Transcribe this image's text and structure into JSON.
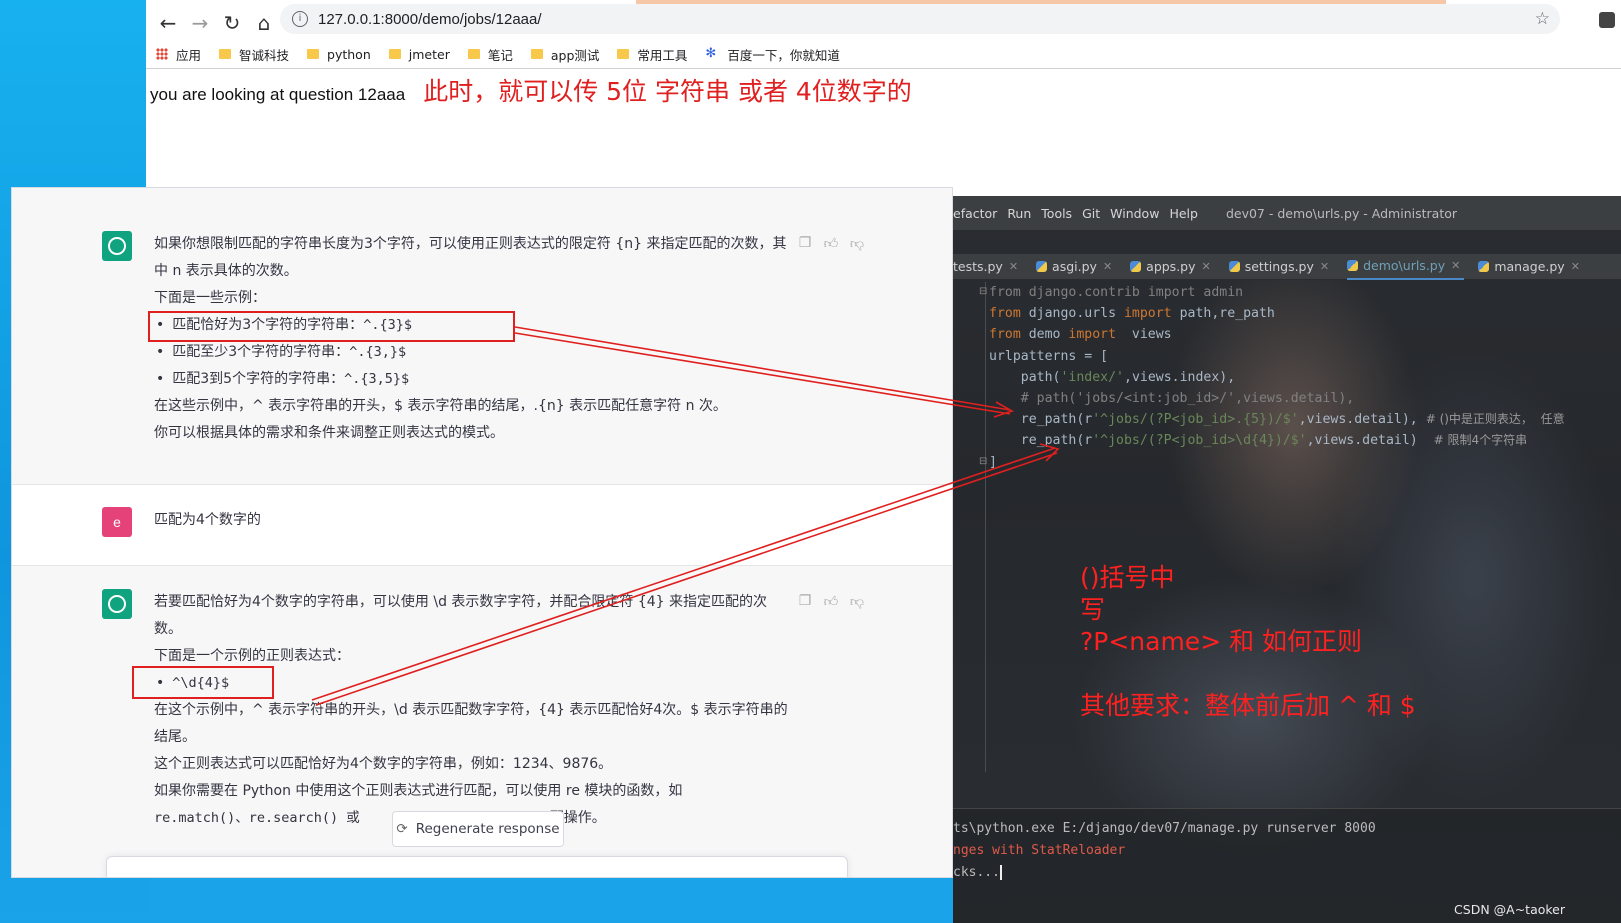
{
  "browser": {
    "url": "127.0.0.1:8000/demo/jobs/12aaa/",
    "bookmarks": [
      {
        "label": "应用",
        "icon": "apps-grid-icon"
      },
      {
        "label": "智诚科技",
        "icon": "folder-icon"
      },
      {
        "label": "python",
        "icon": "folder-icon"
      },
      {
        "label": "jmeter",
        "icon": "folder-icon"
      },
      {
        "label": "笔记",
        "icon": "folder-icon"
      },
      {
        "label": "app测试",
        "icon": "folder-icon"
      },
      {
        "label": "常用工具",
        "icon": "folder-icon"
      },
      {
        "label": "百度一下，你就知道",
        "icon": "baidu-paw-icon"
      }
    ],
    "page_text": "you are looking at question 12aaa",
    "page_note": "此时，就可以传 5位 字符串    或者  4位数字的"
  },
  "ide": {
    "menu": [
      "efactor",
      "Run",
      "Tools",
      "Git",
      "Window",
      "Help"
    ],
    "window_title": "dev07 - demo\\urls.py - Administrator",
    "tabs": [
      {
        "label": "tests.py",
        "active": false
      },
      {
        "label": "asgi.py",
        "active": false
      },
      {
        "label": "apps.py",
        "active": false
      },
      {
        "label": "settings.py",
        "active": false
      },
      {
        "label": "demo\\urls.py",
        "active": true
      },
      {
        "label": "manage.py",
        "active": false
      }
    ],
    "code": {
      "l1_kw1": "from",
      "l1_mod": " django.contrib ",
      "l1_kw2": "import",
      "l1_name": " admin",
      "l2_kw1": "from",
      "l2_mod": " django.urls ",
      "l2_kw2": "import",
      "l2_name": " path,re_path",
      "l3_kw1": "from",
      "l3_mod": " demo ",
      "l3_kw2": "import",
      "l3_name": "  views",
      "l4": "urlpatterns = [",
      "l5_a": "    path(",
      "l5_str": "'index/'",
      "l5_b": ",views.index),",
      "l6": "    # path('jobs/<int:job_id>/',views.detail),",
      "l7_a": "    re_path(r",
      "l7_str": "'^jobs/(?P<job_id>.{5})/$'",
      "l7_b": ",views.detail), ",
      "l7_cmt": "# ()中是正则表达，  任意",
      "l8_a": "    re_path(r",
      "l8_str": "'^jobs/(?P<job_id>\\d{4})/$'",
      "l8_b": ",views.detail)  ",
      "l8_cmt": "# 限制4个字符串",
      "l9": "]"
    },
    "annotation": {
      "line1": "()括号中",
      "line2": "写",
      "line3": "?P<name>  和  如何正则",
      "line4": "其他要求：整体前后加 ^ 和  $"
    },
    "terminal": {
      "t1": "ts\\python.exe E:/django/dev07/manage.py runserver 8000",
      "t2": "nges with StatReloader",
      "t3": "cks..."
    },
    "watermark": "CSDN @A~taoker"
  },
  "chat": {
    "msg1": {
      "p1": "如果你想限制匹配的字符串长度为3个字符，可以使用正则表达式的限定符 {n} 来指定匹配的次数，其中 n 表示具体的次数。",
      "p2": "下面是一些示例：",
      "li1_text": "匹配恰好为3个字符的字符串：",
      "li1_code": "^.{3}$",
      "li2_text": "匹配至少3个字符的字符串：",
      "li2_code": "^.{3,}$",
      "li3_text": "匹配3到5个字符的字符串：",
      "li3_code": "^.{3,5}$",
      "p3": "在这些示例中，^ 表示字符串的开头，$ 表示字符串的结尾，.{n} 表示匹配任意字符 n 次。",
      "p4": "你可以根据具体的需求和条件来调整正则表达式的模式。"
    },
    "user_msg": {
      "avatar": "e",
      "text": "匹配为4个数字的"
    },
    "msg2": {
      "p1": "若要匹配恰好为4个数字的字符串，可以使用 \\d 表示数字字符，并配合限定符 {4} 来指定匹配的次数。",
      "p2": "下面是一个示例的正则表达式：",
      "li1_code": "^\\d{4}$",
      "p3": "在这个示例中，^ 表示字符串的开头，\\d 表示匹配数字字符，{4} 表示匹配恰好4次。$ 表示字符串的结尾。",
      "p4": "这个正则表达式可以匹配恰好为4个数字的字符串，例如：1234、9876。",
      "p5": "如果你需要在 Python 中使用这个正则表达式进行匹配，可以使用 re 模块的函数，如",
      "p6_a": "re.match()、re.search() 或",
      "p6_b": "配操作。"
    },
    "regenerate_label": "Regenerate response"
  }
}
